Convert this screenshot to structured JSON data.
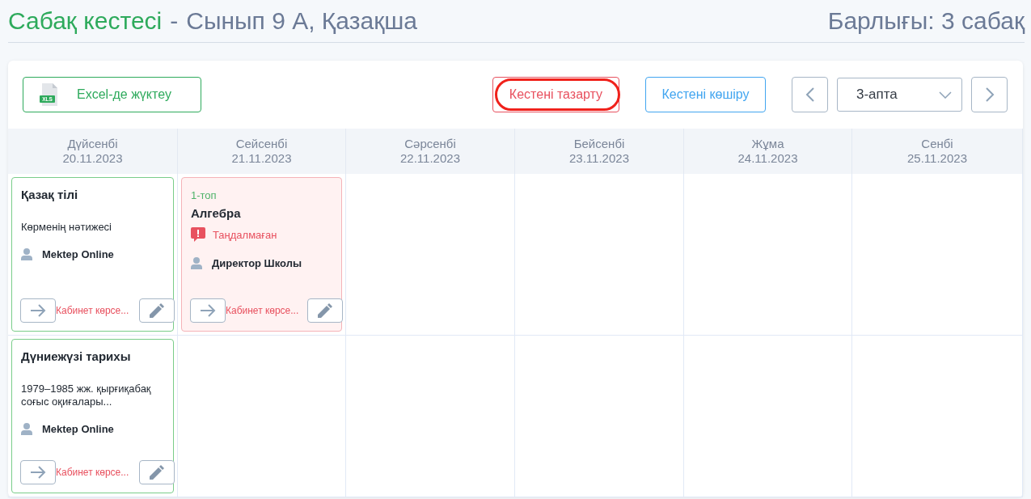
{
  "header": {
    "title": "Сабақ кестесі",
    "separator": "-",
    "subtitle": "Сынып 9 А, Қазақша",
    "total": "Барлығы: 3 сабақ"
  },
  "toolbar": {
    "export": {
      "label": "Excel-де жүктеу",
      "file_badge": "XLS"
    },
    "clear": {
      "label": "Кестені тазарту",
      "highlighted": true
    },
    "copy": {
      "label": "Кестені көшіру"
    },
    "week": {
      "value": "3-апта"
    }
  },
  "days": [
    {
      "name": "Дүйсенбі",
      "date": "20.11.2023"
    },
    {
      "name": "Сейсенбі",
      "date": "21.11.2023"
    },
    {
      "name": "Сәрсенбі",
      "date": "22.11.2023"
    },
    {
      "name": "Бейсенбі",
      "date": "23.11.2023"
    },
    {
      "name": "Жұма",
      "date": "24.11.2023"
    },
    {
      "name": "Сенбі",
      "date": "25.11.2023"
    }
  ],
  "rows": [
    {
      "slots": [
        {
          "kind": "lesson",
          "flagged": false,
          "subject": "Қазақ тілі",
          "topic": "Көрменің нәтижесі",
          "teacher": "Mektep Online",
          "room": "Кабинет көрсе..."
        },
        {
          "kind": "lesson",
          "flagged": true,
          "group": "1-топ",
          "subject": "Алгебра",
          "warning": "Таңдалмаған",
          "teacher": "Директор Школы",
          "room": "Кабинет көрсе..."
        },
        {
          "kind": "empty"
        },
        {
          "kind": "empty"
        },
        {
          "kind": "empty"
        },
        {
          "kind": "empty"
        }
      ]
    },
    {
      "slots": [
        {
          "kind": "lesson",
          "flagged": false,
          "subject": "Дүниежүзі тарихы",
          "topic": "1979–1985 жж. қырғиқабақ соғыс оқиғалары...",
          "teacher": "Mektep Online",
          "room": "Кабинет көрсе..."
        },
        {
          "kind": "empty"
        },
        {
          "kind": "empty"
        },
        {
          "kind": "empty"
        },
        {
          "kind": "empty"
        },
        {
          "kind": "empty"
        }
      ]
    }
  ]
}
